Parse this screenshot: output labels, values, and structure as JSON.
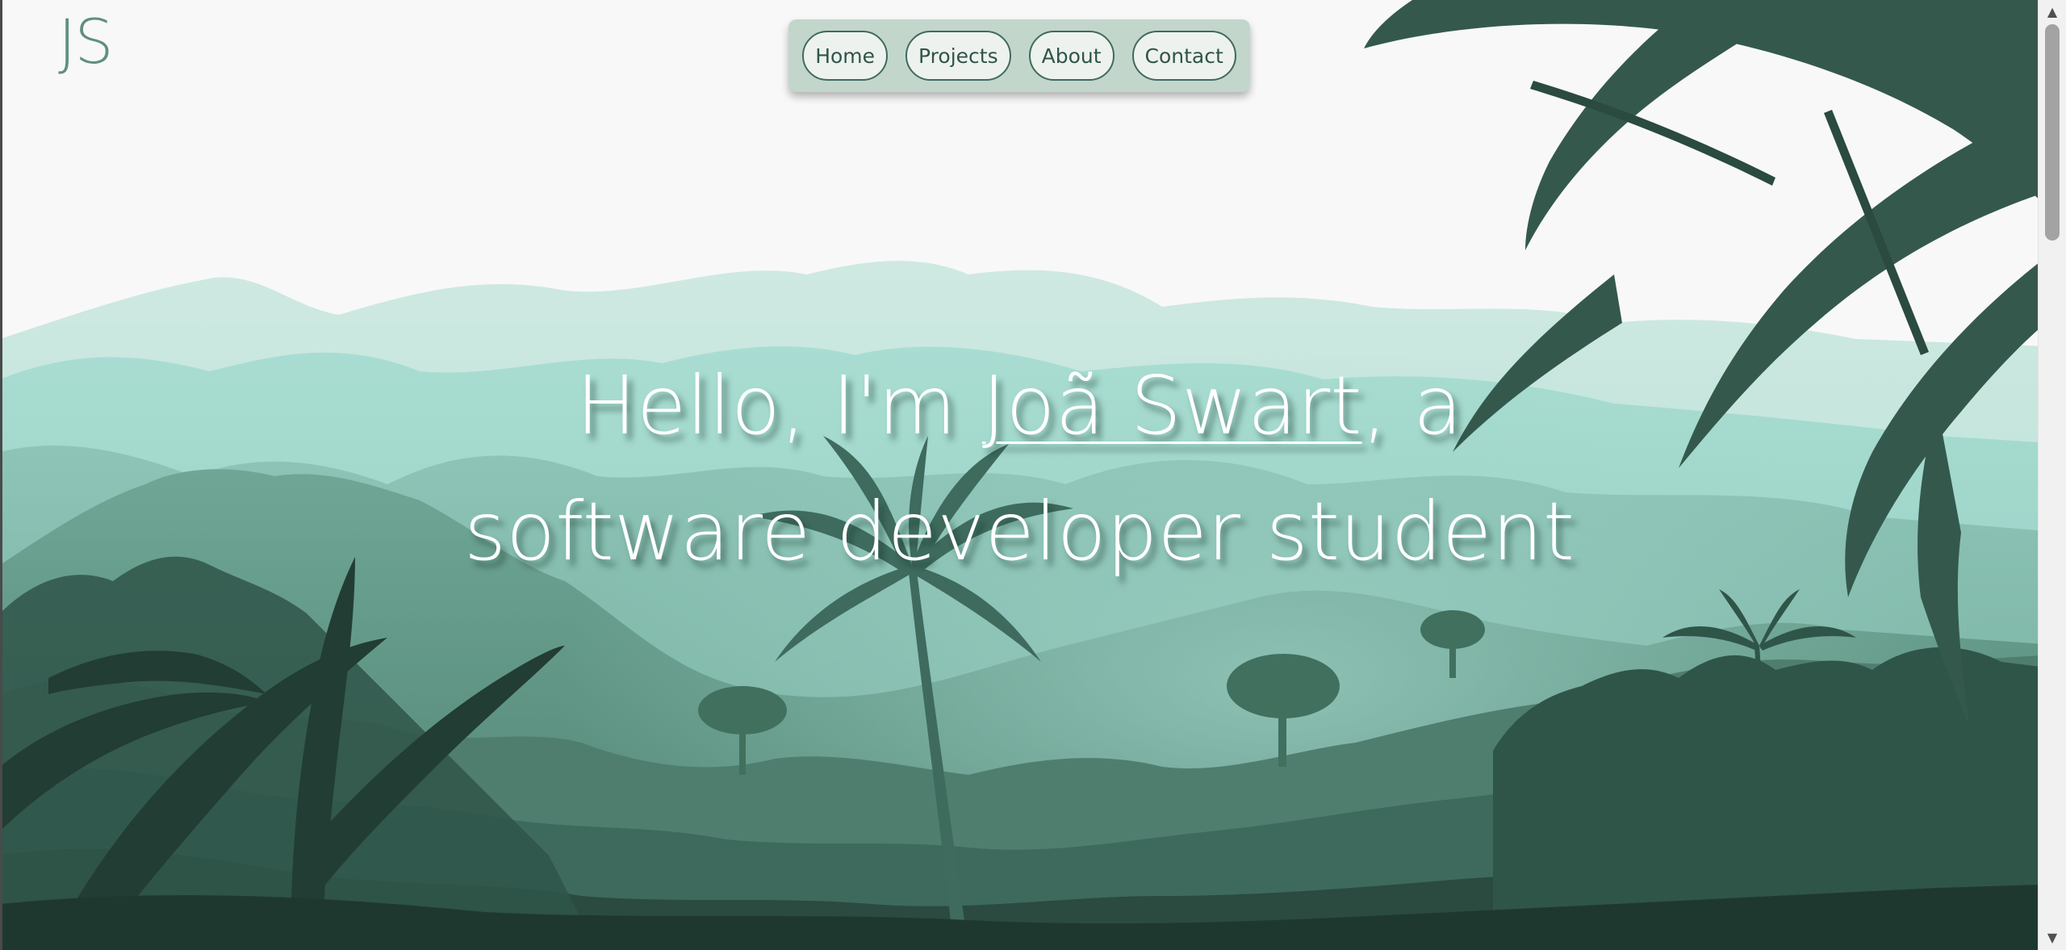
{
  "logo": {
    "text": "JS"
  },
  "nav": {
    "items": [
      {
        "label": "Home"
      },
      {
        "label": "Projects"
      },
      {
        "label": "About"
      },
      {
        "label": "Contact"
      }
    ]
  },
  "hero": {
    "line1_prefix": "Hello, I'm ",
    "name": "Joã Swart",
    "line1_suffix": ", a",
    "line2": "software developer student"
  },
  "colors": {
    "background": "#f8f8f8",
    "accent": "#5f8f7f",
    "nav_bg": "#c3d6cc",
    "jungle_dark": "#2b4a40"
  }
}
